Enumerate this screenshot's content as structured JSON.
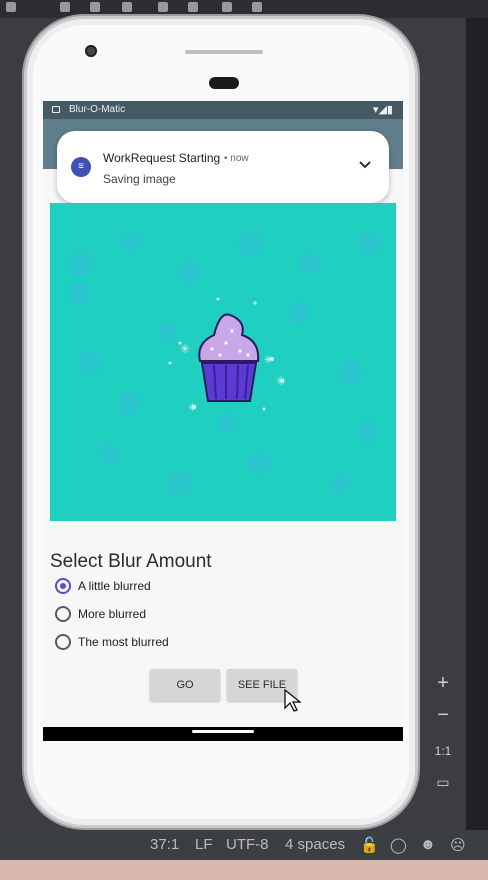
{
  "status_bar": {
    "app_name": "Blur-O-Matic",
    "system_icons": "▾◢▮"
  },
  "notification": {
    "icon": "workmanager-notification-icon",
    "title": "WorkRequest Starting",
    "time": "• now",
    "text": "Saving image",
    "expand_icon": "chevron-down-icon"
  },
  "image": {
    "subject": "cupcake",
    "background_color": "#1fd0c0"
  },
  "blur_section": {
    "heading": "Select Blur Amount",
    "options": [
      {
        "label": "A little blurred",
        "checked": true
      },
      {
        "label": "More blurred",
        "checked": false
      },
      {
        "label": "The most blurred",
        "checked": false
      }
    ]
  },
  "buttons": {
    "go": "GO",
    "see_file": "SEE FILE"
  },
  "host_status": {
    "position": "37:1",
    "line_ending": "LF",
    "encoding": "UTF-8",
    "indent": "4 spaces"
  },
  "emulator_tools": {
    "zoom_in": "+",
    "zoom_out": "−",
    "one_to_one": "1:1"
  },
  "colors": {
    "app_bar": "#607d8b",
    "status_bar": "#455a64",
    "accent": "#5c4ad6"
  }
}
